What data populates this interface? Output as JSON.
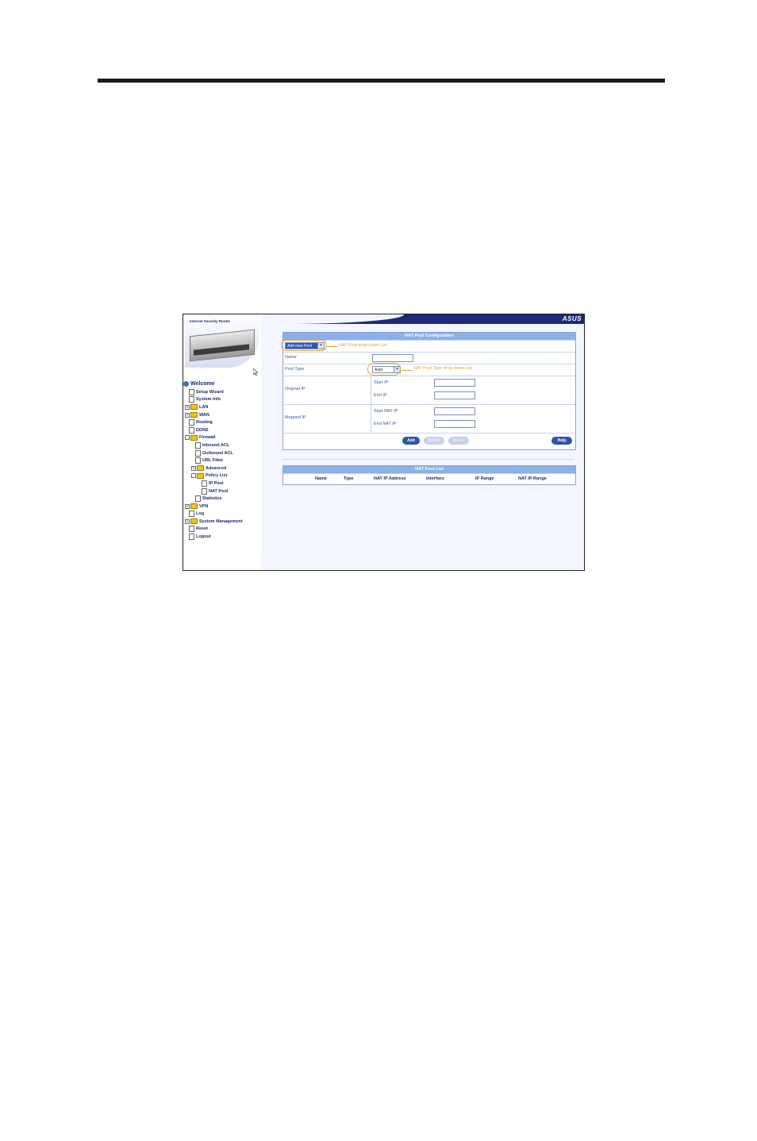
{
  "brand": {
    "logo": "ASUS",
    "product_title": "Internet Security Router"
  },
  "tree": {
    "root": "Welcome",
    "items": [
      {
        "label": "Setup Wizard",
        "level": 1,
        "kind": "doc"
      },
      {
        "label": "System Info",
        "level": 1,
        "kind": "doc"
      },
      {
        "label": "LAN",
        "level": 1,
        "kind": "folder",
        "expander": "+"
      },
      {
        "label": "WAN",
        "level": 1,
        "kind": "folder",
        "expander": "+"
      },
      {
        "label": "Routing",
        "level": 1,
        "kind": "doc"
      },
      {
        "label": "DDNS",
        "level": 1,
        "kind": "doc"
      },
      {
        "label": "Firewall",
        "level": 1,
        "kind": "folder",
        "expander": "-"
      },
      {
        "label": "Inbound ACL",
        "level": 2,
        "kind": "doc"
      },
      {
        "label": "Outbound ACL",
        "level": 2,
        "kind": "doc"
      },
      {
        "label": "URL Filter",
        "level": 2,
        "kind": "doc"
      },
      {
        "label": "Advanced",
        "level": 2,
        "kind": "folder",
        "expander": "+"
      },
      {
        "label": "Policy List",
        "level": 2,
        "kind": "folder",
        "expander": "-"
      },
      {
        "label": "IP Pool",
        "level": 3,
        "kind": "doc"
      },
      {
        "label": "NAT Pool",
        "level": 3,
        "kind": "doc"
      },
      {
        "label": "Statistics",
        "level": 2,
        "kind": "doc"
      },
      {
        "label": "VPN",
        "level": 1,
        "kind": "folder",
        "expander": "+"
      },
      {
        "label": "Log",
        "level": 1,
        "kind": "doc"
      },
      {
        "label": "System Management",
        "level": 1,
        "kind": "folder",
        "expander": "+"
      },
      {
        "label": "Reset",
        "level": 1,
        "kind": "doc"
      },
      {
        "label": "Logout",
        "level": 1,
        "kind": "doc"
      }
    ]
  },
  "config": {
    "title": "NAT Pool Configuration",
    "pool_select": "Add new Pool",
    "pool_select_note": "NAT Pool drop-down List",
    "name_label": "Name",
    "pool_type_label": "Pool Type",
    "pool_type_value": "Auto",
    "pool_type_note": "NAT Pool Type drop-down List",
    "original_ip_label": "Original IP",
    "start_ip_label": "Start IP",
    "end_ip_label": "End IP",
    "mapped_ip_label": "Mapped IP",
    "start_nat_ip_label": "Start NAT IP",
    "end_nat_ip_label": "End NAT IP",
    "buttons": {
      "add": "Add",
      "modify": "Modify",
      "delete": "Delete",
      "help": "Help"
    }
  },
  "list": {
    "title": "NAT Pool List",
    "columns": [
      "Name",
      "Type",
      "NAT IP Address",
      "Interface",
      "IP Range",
      "NAT IP Range"
    ]
  },
  "colors": {
    "header_bar": "#1e2a78",
    "panel_head": "#8cb0e8",
    "annotation": "#e3a62a",
    "button": "#2f55a8"
  }
}
